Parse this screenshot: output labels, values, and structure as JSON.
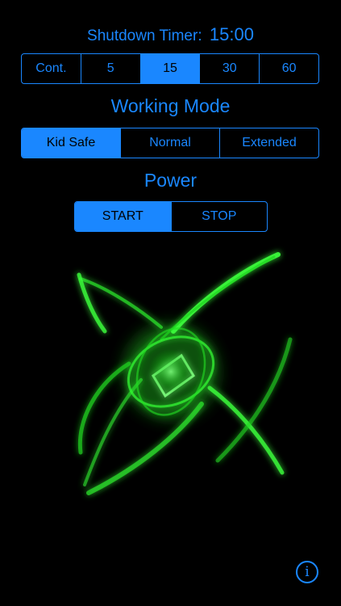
{
  "timer": {
    "label": "Shutdown Timer:",
    "value": "15:00",
    "options": [
      "Cont.",
      "5",
      "15",
      "30",
      "60"
    ],
    "selected": "15"
  },
  "working_mode": {
    "title": "Working Mode",
    "options": [
      "Kid Safe",
      "Normal",
      "Extended"
    ],
    "selected": "Kid Safe"
  },
  "power": {
    "title": "Power",
    "options": [
      "START",
      "STOP"
    ],
    "selected": "START"
  },
  "graphic": {
    "icon": "green-swirl-visualizer",
    "color": "#33ff33"
  },
  "info": {
    "label": "i",
    "icon": "info-icon"
  },
  "colors": {
    "accent": "#1a87ff",
    "background": "#000000"
  }
}
